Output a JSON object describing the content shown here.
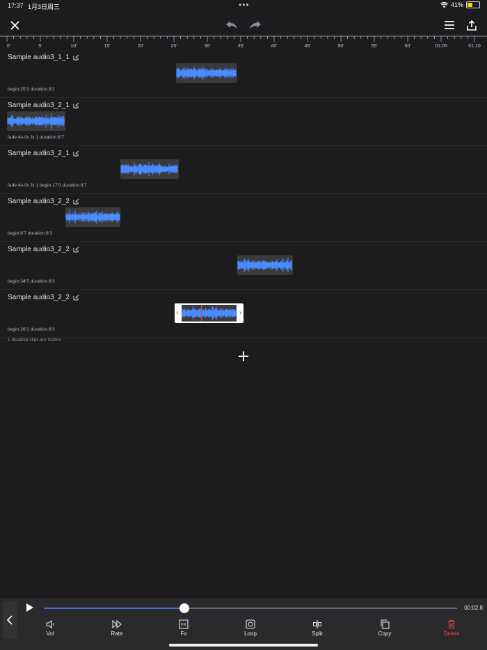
{
  "status_bar": {
    "time": "17:37",
    "date": "1月3日周三",
    "battery_text": "41%",
    "battery_level": 0.41
  },
  "toolbar": {
    "icons": [
      "close-icon",
      "undo-icon",
      "redo-icon",
      "menu-icon",
      "share-icon"
    ]
  },
  "ruler": {
    "labels": [
      "0'",
      "5'",
      "10'",
      "15'",
      "20'",
      "25'",
      "30'",
      "35'",
      "40'",
      "45'",
      "50'",
      "55'",
      "60'",
      "01:05",
      "01:10"
    ],
    "major_step_seconds": 5,
    "max_seconds": 70
  },
  "tracks": [
    {
      "title": "Sample audio3_1_1",
      "meta": "begin:25'3  duration:9'2",
      "clip_start": 25.3,
      "clip_duration": 9.2,
      "selected": false
    },
    {
      "title": "Sample audio3_2_1",
      "meta": "fade:4s-0s  fx:1  duration:8'7",
      "clip_start": 0,
      "clip_duration": 8.7,
      "selected": false
    },
    {
      "title": "Sample audio3_2_1",
      "meta": "fade:4s-0s  fx:1  begin:17'0  duration:8'7",
      "clip_start": 17.0,
      "clip_duration": 8.7,
      "selected": false
    },
    {
      "title": "Sample audio3_2_2",
      "meta": "begin:8'7  duration:8'3",
      "clip_start": 8.7,
      "clip_duration": 8.3,
      "selected": false
    },
    {
      "title": "Sample audio3_2_2",
      "meta": "begin:34'5  duration:8'3",
      "clip_start": 34.5,
      "clip_duration": 8.3,
      "selected": false
    },
    {
      "title": "Sample audio3_2_2",
      "meta": "begin:26'1  duration:8'3",
      "clip_start": 26.1,
      "clip_duration": 8.3,
      "selected": true
    }
  ],
  "hidden_note": "1 disabled clips are hidden",
  "transport": {
    "time": "00:02.8",
    "progress": 0.34
  },
  "tools": [
    {
      "label": "Vol",
      "icon": "speaker-icon"
    },
    {
      "label": "Rate",
      "icon": "fast-forward-icon"
    },
    {
      "label": "Fx",
      "icon": "fx-icon"
    },
    {
      "label": "Loop",
      "icon": "loop-icon"
    },
    {
      "label": "Split",
      "icon": "split-icon"
    },
    {
      "label": "Copy",
      "icon": "copy-icon"
    },
    {
      "label": "Delete",
      "icon": "trash-icon"
    }
  ],
  "colors": {
    "accent": "#3d6fd8",
    "waveform": "#4a8cff",
    "danger": "#e2434e",
    "background": "#1c1c1e"
  }
}
